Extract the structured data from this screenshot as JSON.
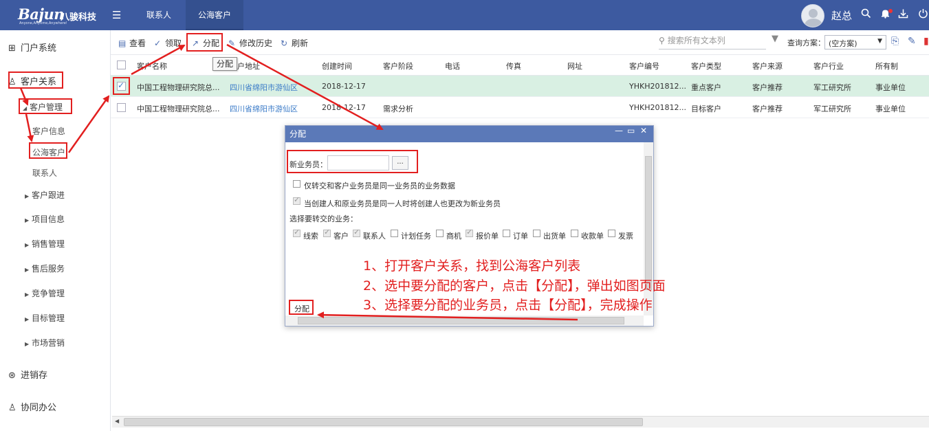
{
  "header": {
    "logo_text": "Bajun",
    "logo_cn": "八骏科技",
    "logo_tagline": "Anyone,Anytime,Anywhere!",
    "menu_icon": "hamburger-icon",
    "tabs": [
      {
        "label": "联系人"
      },
      {
        "label": "公海客户"
      }
    ],
    "username": "赵总",
    "icons": [
      "search-icon",
      "bell-icon",
      "download-icon",
      "power-icon"
    ]
  },
  "sidebar": {
    "portal": "门户系统",
    "crm": "客户关系",
    "customer_mgmt": "客户管理",
    "customer_info": "客户信息",
    "public_customers": "公海客户",
    "contacts": "联系人",
    "groups": [
      "客户跟进",
      "项目信息",
      "销售管理",
      "售后服务",
      "竞争管理",
      "目标管理",
      "市场营销"
    ],
    "inventory": "进销存",
    "office": "协同办公"
  },
  "toolbar": {
    "view": "查看",
    "claim": "领取",
    "assign": "分配",
    "history": "修改历史",
    "refresh": "刷新",
    "tooltip": "分配",
    "search_placeholder": "搜索所有文本列",
    "scheme_label": "查询方案：",
    "scheme_value": "(空方案)"
  },
  "table": {
    "columns": [
      "客户名称",
      "客户地址",
      "创建时间",
      "客户阶段",
      "电话",
      "传真",
      "网址",
      "客户编号",
      "客户类型",
      "客户来源",
      "客户行业",
      "所有制"
    ],
    "rows": [
      {
        "name": "中国工程物理研究院总...",
        "address": "四川省绵阳市游仙区",
        "created": "2018-12-17",
        "stage": "",
        "phone": "",
        "fax": "",
        "website": "",
        "code": "YHKH201812...",
        "type": "重点客户",
        "source": "客户推荐",
        "industry": "军工研究所",
        "ownership": "事业单位",
        "selected": true
      },
      {
        "name": "中国工程物理研究院总...",
        "address": "四川省绵阳市游仙区",
        "created": "2018-12-17",
        "stage": "需求分析",
        "phone": "",
        "fax": "",
        "website": "",
        "code": "YHKH201812...",
        "type": "目标客户",
        "source": "客户推荐",
        "industry": "军工研究所",
        "ownership": "事业单位",
        "selected": false
      }
    ]
  },
  "dialog": {
    "title": "分配",
    "new_salesman_label": "新业务员：",
    "new_salesman_value": "",
    "picker_button": "...",
    "option1": "仅转交和客户业务员是同一业务员的业务数据",
    "option2": "当创建人和原业务员是同一人时将创建人也更改为新业务员",
    "business_label": "选择要转交的业务：",
    "business_items": [
      {
        "label": "线索",
        "checked": true
      },
      {
        "label": "客户",
        "checked": true
      },
      {
        "label": "联系人",
        "checked": true
      },
      {
        "label": "计划任务",
        "checked": false
      },
      {
        "label": "商机",
        "checked": false
      },
      {
        "label": "报价单",
        "checked": true
      },
      {
        "label": "订单",
        "checked": false
      },
      {
        "label": "出货单",
        "checked": false
      },
      {
        "label": "收款单",
        "checked": false
      },
      {
        "label": "发票",
        "checked": false
      }
    ],
    "submit": "分配"
  },
  "annotations": [
    "1、打开客户关系，找到公海客户列表",
    "2、选中要分配的客户，点击【分配】，弹出如图页面",
    "3、选择要分配的业务员，点击【分配】，完成操作"
  ],
  "colors": {
    "header_bg": "#3d5aa0",
    "annotation": "#e21f1f",
    "selected_row": "#d9f0e3",
    "dialog_title": "#5b79b8"
  }
}
